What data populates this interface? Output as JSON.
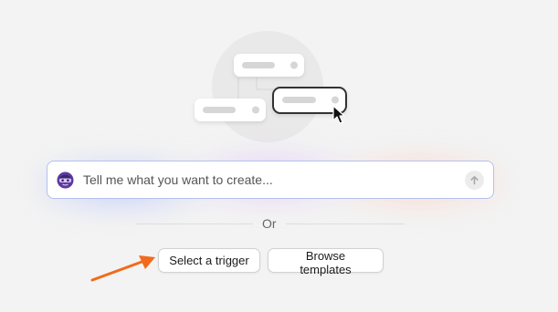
{
  "illustration": {
    "icon": "workflow-nodes-icon",
    "cursor_icon": "mouse-pointer-icon"
  },
  "prompt": {
    "placeholder": "Tell me what you want to create...",
    "value": "",
    "avatar_icon": "masked-assistant-avatar-icon",
    "send_icon": "arrow-up-icon"
  },
  "divider": {
    "label": "Or"
  },
  "actions": {
    "select_trigger_label": "Select a trigger",
    "browse_templates_label": "Browse templates"
  },
  "annotation": {
    "icon": "pointer-arrow-icon",
    "color": "#f26a1b"
  },
  "colors": {
    "background": "#f3f3f3",
    "input_border": "#b4c0ef",
    "avatar_purple": "#5b3aa0"
  }
}
